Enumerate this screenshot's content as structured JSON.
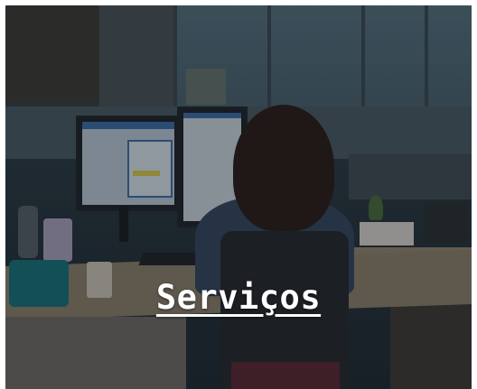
{
  "card": {
    "title": "Serviços",
    "image": "office-worker-at-desk-photo"
  },
  "colors": {
    "title_text": "#ffffff",
    "overlay": "#0c1218"
  }
}
